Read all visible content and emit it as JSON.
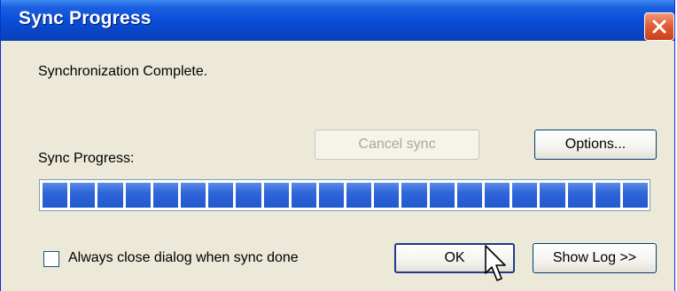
{
  "window": {
    "title": "Sync Progress"
  },
  "status_message": "Synchronization Complete.",
  "progress": {
    "label": "Sync Progress:",
    "fraction": 1.0,
    "segments": 22
  },
  "buttons": {
    "cancel_sync": "Cancel sync",
    "options": "Options...",
    "ok": "OK",
    "show_log": "Show Log >>"
  },
  "checkbox": {
    "label": "Always close dialog when sync done",
    "checked": false
  },
  "colors": {
    "titlebar": "#0a50d8",
    "progress_fill": "#2f66d8",
    "dialog_bg": "#ece9d8",
    "close_button": "#e35e38"
  },
  "icons": {
    "close": "close-icon",
    "cursor": "mouse-pointer-icon"
  }
}
